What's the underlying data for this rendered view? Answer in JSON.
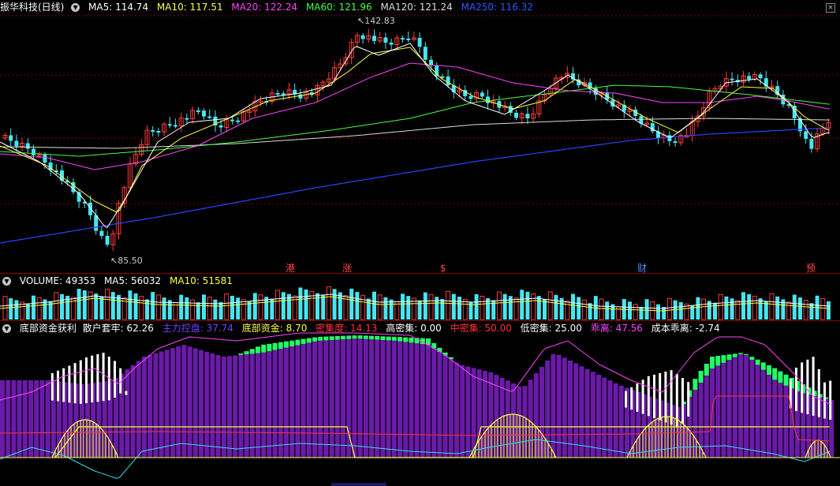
{
  "main": {
    "title": "振华科技(日线)",
    "ma": [
      {
        "label": "MA5: 114.74",
        "color": "#ffffff"
      },
      {
        "label": "MA10: 117.51",
        "color": "#ffff44"
      },
      {
        "label": "MA20: 122.24",
        "color": "#ff44ff"
      },
      {
        "label": "MA60: 121.96",
        "color": "#44ff44"
      },
      {
        "label": "MA120: 121.24",
        "color": "#dddddd"
      },
      {
        "label": "MA250: 116.32",
        "color": "#3355ff"
      }
    ],
    "high_label": "142.83",
    "low_label": "85.50",
    "markers": [
      {
        "text": "港",
        "color": "#ff4444"
      },
      {
        "text": "涨",
        "color": "#ff4444"
      },
      {
        "text": "$",
        "color": "#ff4444"
      },
      {
        "text": "财",
        "color": "#4a8cff"
      },
      {
        "text": "预",
        "color": "#ff4444"
      }
    ]
  },
  "volume": {
    "label": "VOLUME: 49353",
    "ma5": "MA5: 56032",
    "ma10": "MA10: 51581"
  },
  "indicator": {
    "name": "底部资金获利",
    "items": [
      {
        "label": "散户套牢: 62.26",
        "color": "#ffffff"
      },
      {
        "label": "主力控盘: 37.74",
        "color": "#7a3cff"
      },
      {
        "label": "底部资金: 8.70",
        "color": "#ffff44"
      },
      {
        "label": "密集度: 14.13",
        "color": "#ff3333"
      },
      {
        "label": "高密集: 0.00",
        "color": "#ffffff"
      },
      {
        "label": "中密集: 50.00",
        "color": "#ff3333"
      },
      {
        "label": "低密集: 25.00",
        "color": "#ffffff"
      },
      {
        "label": "乖离: 47.56",
        "color": "#ff44ff"
      },
      {
        "label": "成本乖离: -2.74",
        "color": "#ffffff"
      }
    ]
  },
  "colors": {
    "up": "#ff3c3c",
    "down": "#46e6f0",
    "purple": "#6a1aa8",
    "green": "#22ff66",
    "grid": "#8a0000"
  }
}
